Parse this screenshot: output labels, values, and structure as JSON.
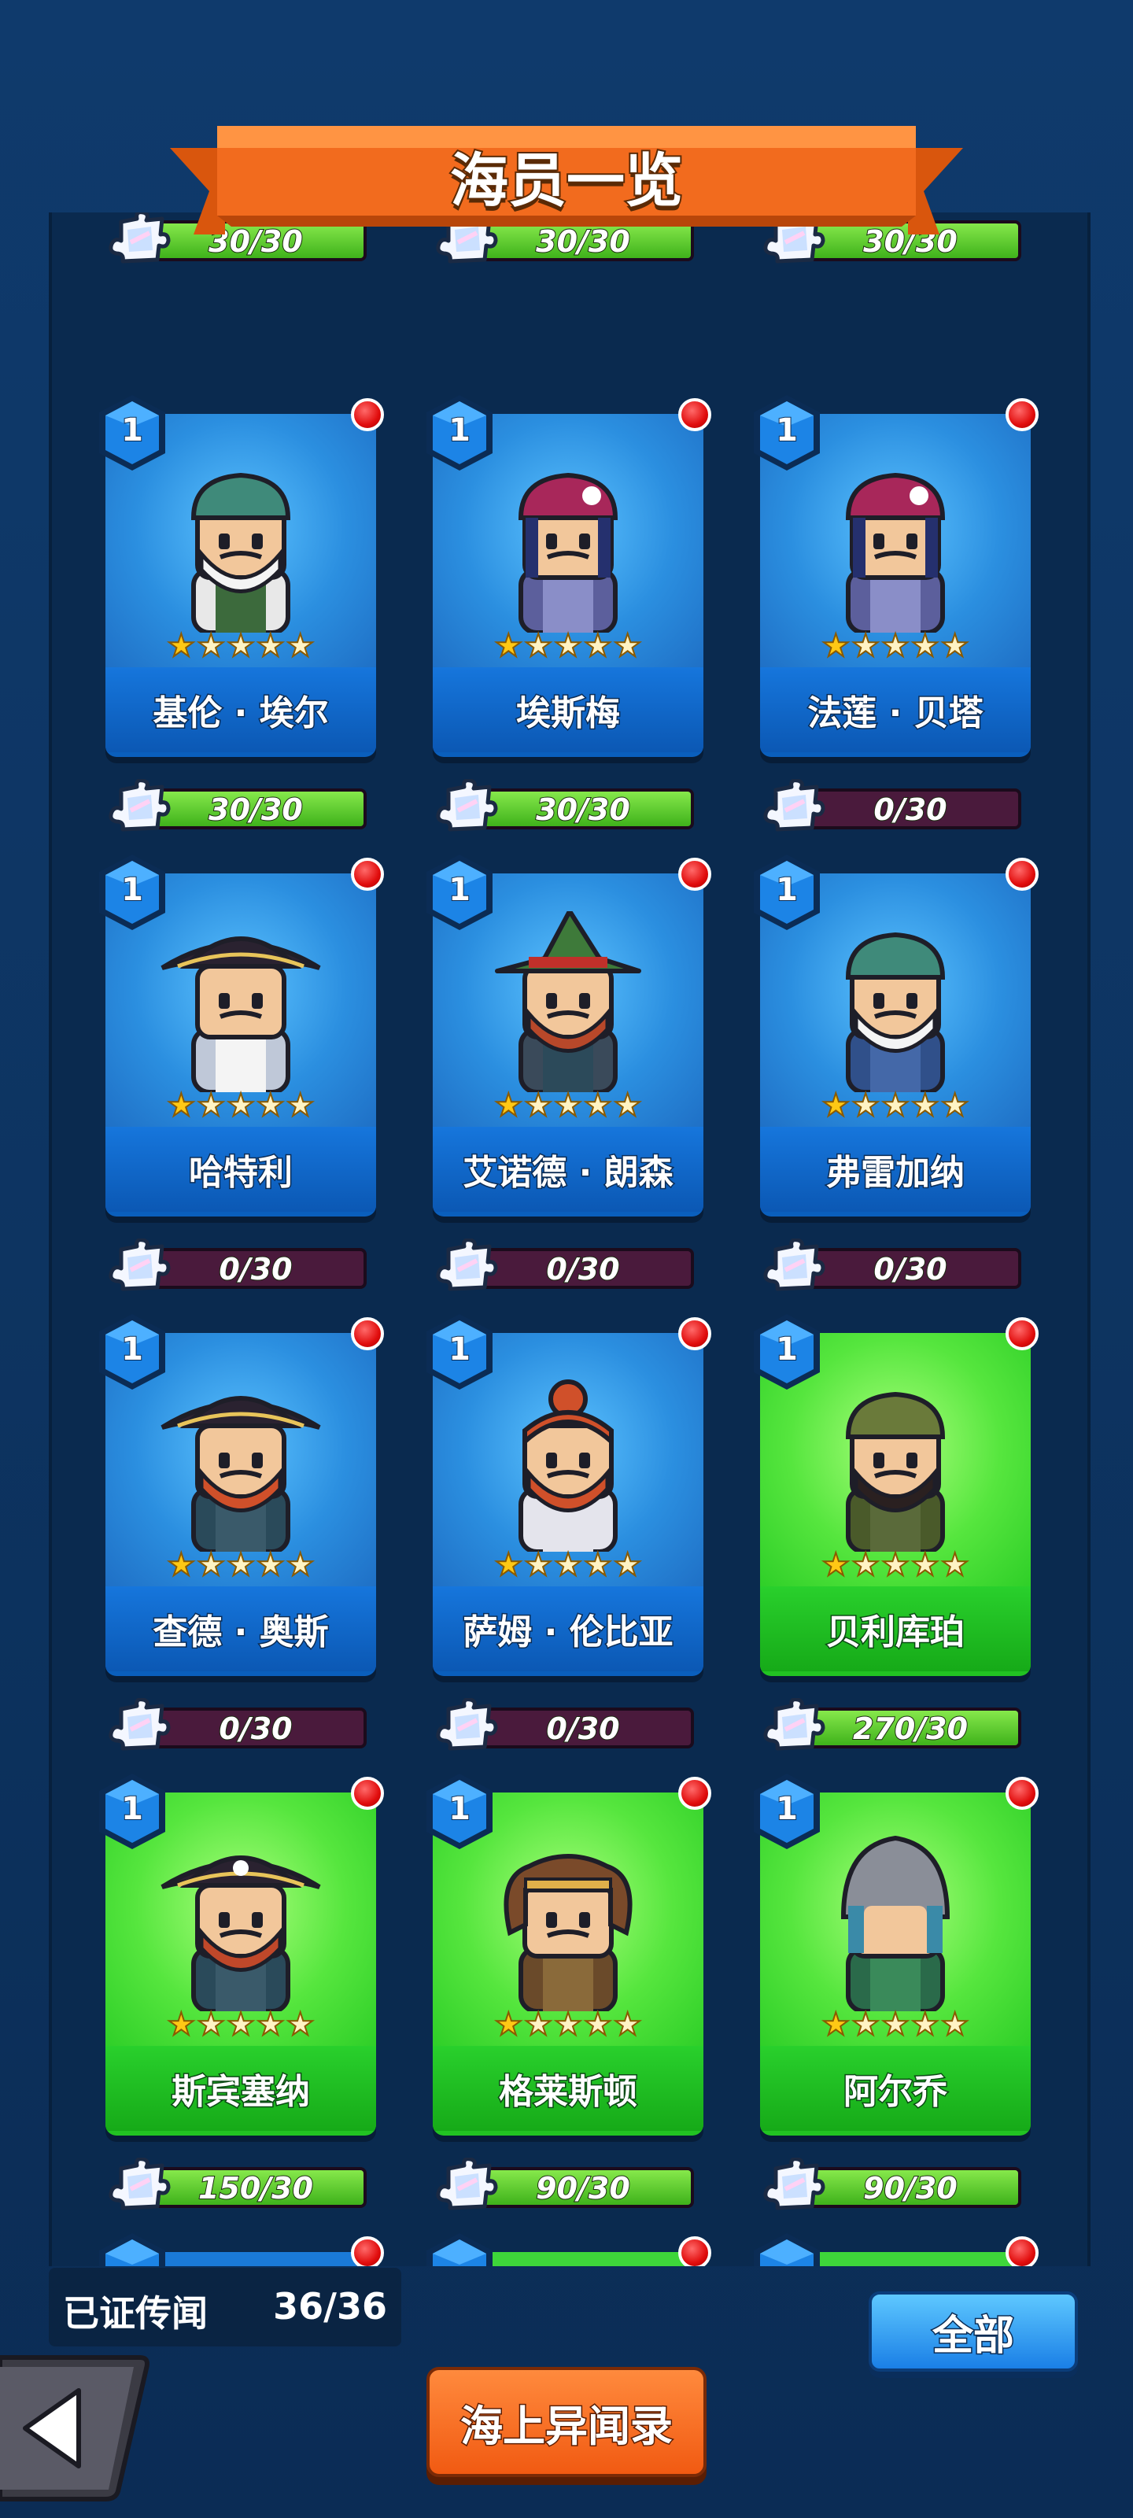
{
  "header": {
    "title": "海员一览"
  },
  "top_row_partial": [
    {
      "shards": "30/30",
      "fill": 1.0
    },
    {
      "shards": "30/30",
      "fill": 1.0
    },
    {
      "shards": "30/30",
      "fill": 1.0
    }
  ],
  "sailors": [
    {
      "name": "基伦 · 埃尔",
      "level": "1",
      "stars": 1,
      "shards": "30/30",
      "fill": 1.0,
      "rarity": "blue",
      "portrait": "bandana-strongman"
    },
    {
      "name": "埃斯梅",
      "level": "1",
      "stars": 1,
      "shards": "30/30",
      "fill": 1.0,
      "rarity": "blue",
      "portrait": "skull-bandana-girl"
    },
    {
      "name": "法莲 · 贝塔",
      "level": "1",
      "stars": 1,
      "shards": "0/30",
      "fill": 0.0,
      "rarity": "blue",
      "portrait": "skull-bandana-girl"
    },
    {
      "name": "哈特利",
      "level": "1",
      "stars": 1,
      "shards": "0/30",
      "fill": 0.0,
      "rarity": "blue",
      "portrait": "tricorn-noble"
    },
    {
      "name": "艾诺德 · 朗森",
      "level": "1",
      "stars": 1,
      "shards": "0/30",
      "fill": 0.0,
      "rarity": "blue",
      "portrait": "green-witch-hat"
    },
    {
      "name": "弗雷加纳",
      "level": "1",
      "stars": 1,
      "shards": "0/30",
      "fill": 0.0,
      "rarity": "blue",
      "portrait": "bandana-elder"
    },
    {
      "name": "查德 · 奥斯",
      "level": "1",
      "stars": 1,
      "shards": "0/30",
      "fill": 0.0,
      "rarity": "blue",
      "portrait": "tricorn-redbeard"
    },
    {
      "name": "萨姆 · 伦比亚",
      "level": "1",
      "stars": 1,
      "shards": "0/30",
      "fill": 0.0,
      "rarity": "blue",
      "portrait": "topknot-redbeard"
    },
    {
      "name": "贝利库珀",
      "level": "1",
      "stars": 1,
      "shards": "270/30",
      "fill": 1.0,
      "rarity": "green",
      "portrait": "camo-bandana"
    },
    {
      "name": "斯宾塞纳",
      "level": "1",
      "stars": 1,
      "shards": "150/30",
      "fill": 1.0,
      "rarity": "green",
      "portrait": "pirate-captain"
    },
    {
      "name": "格莱斯顿",
      "level": "1",
      "stars": 1,
      "shards": "90/30",
      "fill": 1.0,
      "rarity": "green",
      "portrait": "curly-hair-scar"
    },
    {
      "name": "阿尔乔",
      "level": "1",
      "stars": 1,
      "shards": "90/30",
      "fill": 1.0,
      "rarity": "green",
      "portrait": "knight-helmet"
    }
  ],
  "footer": {
    "collected_label": "已证传闻",
    "collected_value": "36/36",
    "filter_button": "全部",
    "records_button": "海上异闻录",
    "back_icon": "back-arrow-icon"
  },
  "colors": {
    "accent": "#f36a1c",
    "blue_card": "#0a5fbd",
    "green_card": "#22c322",
    "bar_fill": "#5cc92a",
    "bar_empty": "#4a1a3c"
  }
}
